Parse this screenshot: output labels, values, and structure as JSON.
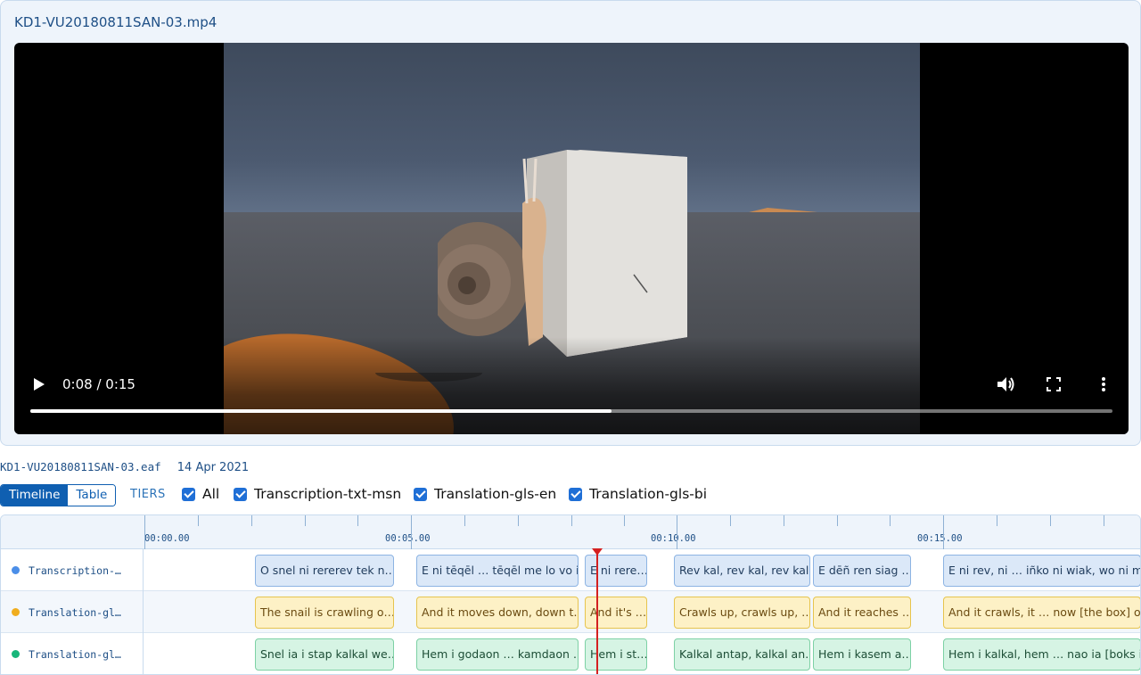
{
  "video": {
    "file_name": "KD1-VU20180811SAN-03.mp4",
    "time_display": "0:08 / 0:15",
    "progress_fraction": 0.537
  },
  "eaf": {
    "file_name": "KD1-VU20180811SAN-03.eaf",
    "date": "14 Apr 2021"
  },
  "toolbar": {
    "tabs": [
      {
        "label": "Timeline",
        "active": true
      },
      {
        "label": "Table",
        "active": false
      }
    ],
    "tiers_label": "TIERS",
    "checkboxes": [
      {
        "label": "All",
        "checked": true
      },
      {
        "label": "Transcription-txt-msn",
        "checked": true
      },
      {
        "label": "Translation-gls-en",
        "checked": true
      },
      {
        "label": "Translation-gls-bi",
        "checked": true
      }
    ]
  },
  "timeline": {
    "ruler_labels": [
      "00:00.00",
      "00:05.00",
      "00:10.00",
      "00:15.00"
    ],
    "playhead_seconds": 8.45,
    "tiers": [
      {
        "name": "Transcription-…",
        "color": "#4b8ee8",
        "style": "blue",
        "annotations": [
          "O snel ni rererev tek n…",
          "E ni tēqēl … tēqēl me lo vo i…",
          "E ni rere…",
          "Rev kal, rev kal, rev kal…",
          "E dēñ ren siag …",
          "E ni rev, ni … iñko ni wiak, wo ni m…"
        ]
      },
      {
        "name": "Translation-gl…",
        "color": "#f0ad1e",
        "style": "yellow",
        "annotations": [
          "The snail is crawling o…",
          "And it moves down, down t…",
          "And it's …",
          "Crawls up, crawls up, …",
          "And it reaches …",
          "And it crawls, it … now [the box] o…"
        ]
      },
      {
        "name": "Translation-gl…",
        "color": "#18b67a",
        "style": "green",
        "annotations": [
          "Snel ia i stap kalkal we…",
          "Hem i godaon … kamdaon …",
          "Hem i st…",
          "Kalkal antap, kalkal an…",
          "Hem i kasem a…",
          "Hem i kalkal, hem … nao ia [boks i…"
        ]
      }
    ]
  }
}
